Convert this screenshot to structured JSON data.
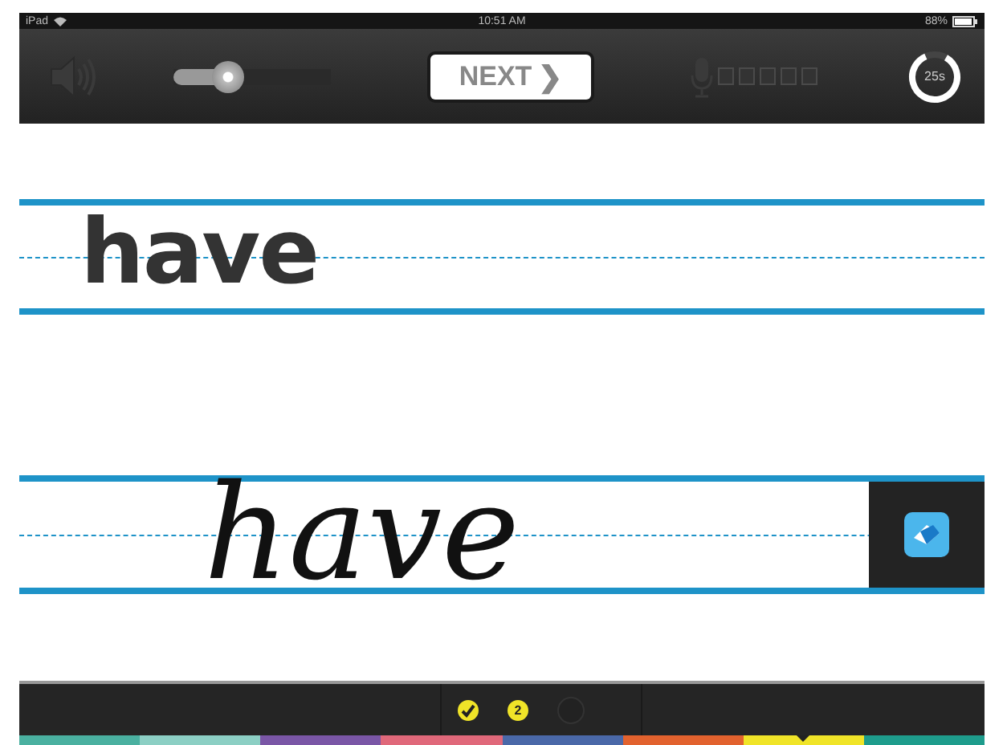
{
  "status_bar": {
    "device": "iPad",
    "time": "10:51 AM",
    "battery": "88%"
  },
  "toolbar": {
    "volume": {
      "level": 0.35
    },
    "next_button": {
      "label": "NEXT",
      "icon": "❯"
    },
    "timer": {
      "label": "25s"
    }
  },
  "model_word": "have",
  "handwriting": "have",
  "progress": [
    {
      "kind": "done"
    },
    {
      "kind": "current",
      "label": "2"
    },
    {
      "kind": "pending"
    }
  ],
  "colors": [
    {
      "color": "#4ab0a0",
      "selected": false
    },
    {
      "color": "#8ccfc4",
      "selected": false
    },
    {
      "color": "#7a56a6",
      "selected": false
    },
    {
      "color": "#e0687a",
      "selected": false
    },
    {
      "color": "#4a68a8",
      "selected": false
    },
    {
      "color": "#e2622e",
      "selected": false
    },
    {
      "color": "#f0e428",
      "selected": true
    },
    {
      "color": "#1e9c8c",
      "selected": false
    }
  ]
}
